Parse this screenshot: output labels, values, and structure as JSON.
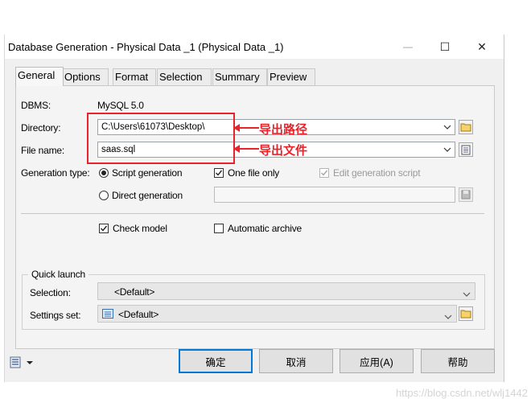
{
  "window": {
    "title": "Database Generation - Physical Data _1 (Physical Data _1)",
    "minimize_glyph": "—",
    "maximize_glyph": "☐",
    "close_glyph": "✕"
  },
  "tabs": [
    {
      "label": "General",
      "active": true
    },
    {
      "label": "Options"
    },
    {
      "label": "Format"
    },
    {
      "label": "Selection"
    },
    {
      "label": "Summary"
    },
    {
      "label": "Preview"
    }
  ],
  "general": {
    "dbms_label": "DBMS:",
    "dbms_value": "MySQL 5.0",
    "directory_label": "Directory:",
    "directory_value": "C:\\Users\\61073\\Desktop\\",
    "filename_label": "File name:",
    "filename_value": "saas.sql",
    "generation_type_label": "Generation type:",
    "script_generation": "Script generation",
    "direct_generation": "Direct generation",
    "one_file_only": "One file only",
    "edit_generation_script": "Edit generation script",
    "check_model": "Check model",
    "automatic_archive": "Automatic archive"
  },
  "quick_launch": {
    "legend": "Quick launch",
    "selection_label": "Selection:",
    "selection_value": "<Default>",
    "settings_label": "Settings set:",
    "settings_value": "<Default>"
  },
  "buttons": {
    "ok": "确定",
    "cancel": "取消",
    "apply": "应用(A)",
    "help": "帮助"
  },
  "annotations": {
    "export_path": "导出路径",
    "export_file": "导出文件"
  },
  "watermark": "https://blog.csdn.net/wlj1442",
  "colors": {
    "annotation_red": "#e8242b",
    "default_button_border": "#0078d7",
    "dialog_bg": "#f0f0f0"
  },
  "icons": [
    "folder-icon",
    "properties-icon",
    "chevron-down-icon",
    "save-settings-icon",
    "check-icon"
  ]
}
